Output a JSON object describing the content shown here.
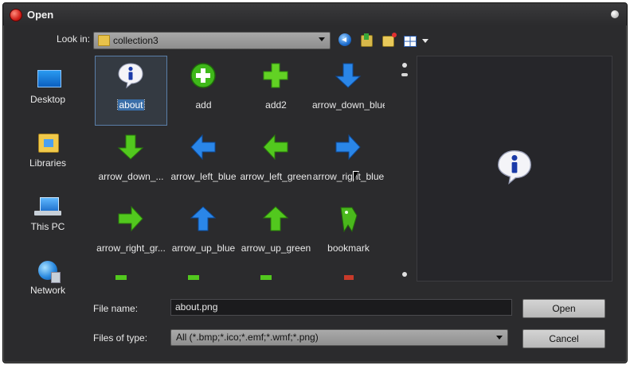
{
  "window": {
    "title": "Open"
  },
  "lookin": {
    "label": "Look in:",
    "value": "collection3"
  },
  "places": [
    {
      "label": "Desktop",
      "icon": "desktop-icon"
    },
    {
      "label": "Libraries",
      "icon": "libraries-icon"
    },
    {
      "label": "This PC",
      "icon": "this-pc-icon"
    },
    {
      "label": "Network",
      "icon": "network-icon"
    }
  ],
  "files": [
    {
      "label": "about",
      "icon": "info-bubble-icon"
    },
    {
      "label": "add",
      "icon": "plus-circle-icon"
    },
    {
      "label": "add2",
      "icon": "plus-icon"
    },
    {
      "label": "arrow_down_blue",
      "icon": "arrow-down-blue-icon"
    },
    {
      "label": "arrow_down_...",
      "icon": "arrow-down-green-icon"
    },
    {
      "label": "arrow_left_blue",
      "icon": "arrow-left-blue-icon"
    },
    {
      "label": "arrow_left_green",
      "icon": "arrow-left-green-icon"
    },
    {
      "label": "arrow_right_blue",
      "icon": "arrow-right-blue-icon"
    },
    {
      "label": "arrow_right_gr...",
      "icon": "arrow-right-green-icon"
    },
    {
      "label": "arrow_up_blue",
      "icon": "arrow-up-blue-icon"
    },
    {
      "label": "arrow_up_green",
      "icon": "arrow-up-green-icon"
    },
    {
      "label": "bookmark",
      "icon": "bookmark-icon"
    }
  ],
  "filename": {
    "label": "File name:",
    "value": "about.png"
  },
  "filetype": {
    "label": "Files of type:",
    "value": "All (*.bmp;*.ico;*.emf;*.wmf;*.png)"
  },
  "buttons": {
    "open": "Open",
    "cancel": "Cancel"
  },
  "colors": {
    "background": "#2b2b2d",
    "green": "#52c81e",
    "blue": "#2a86e8",
    "selection": "#3a6ea8"
  }
}
